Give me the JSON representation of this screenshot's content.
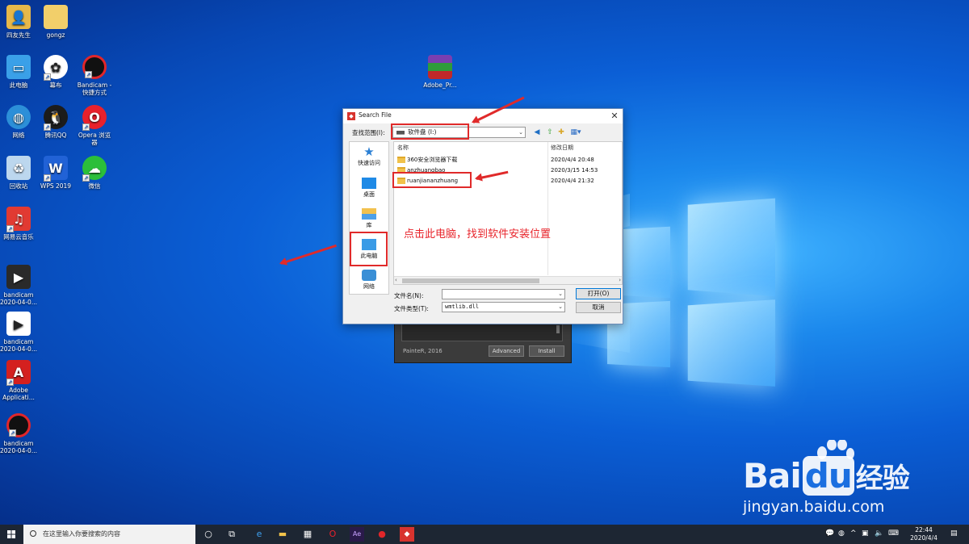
{
  "desktop": {
    "icons": [
      {
        "label": "四友先生"
      },
      {
        "label": "gongz"
      },
      {
        "label": "此电脑"
      },
      {
        "label": "幕布"
      },
      {
        "label": "Bandicam - 快捷方式"
      },
      {
        "label": "网络"
      },
      {
        "label": "腾讯QQ"
      },
      {
        "label": "Opera 浏览器"
      },
      {
        "label": "回收站"
      },
      {
        "label": "WPS 2019"
      },
      {
        "label": "微信"
      },
      {
        "label": "网易云音乐"
      },
      {
        "label": "bandicam 2020-04-0..."
      },
      {
        "label": "bandicam 2020-04-0..."
      },
      {
        "label": "Adobe Applicati..."
      },
      {
        "label": "bandicam 2020-04-0..."
      },
      {
        "label": "Adobe_Pr..."
      }
    ]
  },
  "installer": {
    "credit": "PainteR, 2016",
    "advanced_label": "Advanced",
    "install_label": "Install"
  },
  "dialog": {
    "title": "Search File",
    "close_glyph": "✕",
    "look_in_label": "查找范围(I):",
    "look_in_value": "软件盘 (I:)",
    "places": [
      {
        "label": "快速访问"
      },
      {
        "label": "桌面"
      },
      {
        "label": "库"
      },
      {
        "label": "此电脑"
      },
      {
        "label": "网络"
      }
    ],
    "columns": {
      "name": "名称",
      "modified": "修改日期"
    },
    "files": [
      {
        "name": "360安全浏览器下载",
        "modified": "2020/4/4 20:48"
      },
      {
        "name": "anzhuangbao",
        "modified": "2020/3/15 14:53"
      },
      {
        "name": "ruanjiananzhuang",
        "modified": "2020/4/4 21:32"
      }
    ],
    "filename_label": "文件名(N):",
    "filename_value": "",
    "filetype_label": "文件类型(T):",
    "filetype_value": "wmtlib.dll",
    "open_label": "打开(O)",
    "cancel_label": "取消"
  },
  "annotation": {
    "text": "点击此电脑，找到软件安装位置",
    "color": "#e8242b"
  },
  "watermark": {
    "brand": "Bai",
    "brand_du": "du",
    "brand_cn": "经验",
    "url": "jingyan.baidu.com"
  },
  "taskbar": {
    "search_placeholder": "在这里输入你要搜索的内容",
    "time": "22:44",
    "date": "2020/4/4"
  }
}
